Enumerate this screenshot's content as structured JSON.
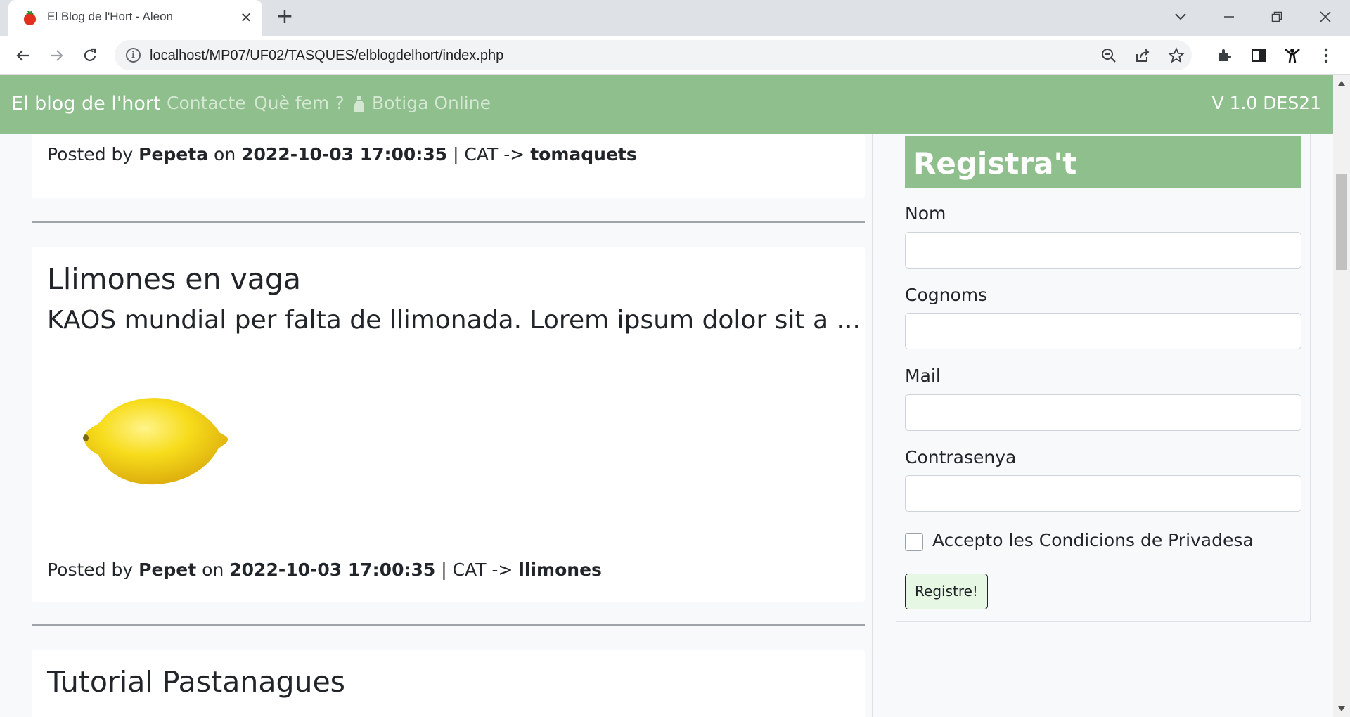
{
  "browser": {
    "tab_title": "El Blog de l'Hort - Aleon",
    "tab_close": "✕",
    "new_tab": "+",
    "url": "localhost/MP07/UF02/TASQUES/elblogdelhort/index.php"
  },
  "navbar": {
    "brand": "El blog de l'hort",
    "links": [
      "Contacte",
      "Què fem ?",
      "Botiga Online"
    ],
    "version": "V 1.0 DES21"
  },
  "posts": [
    {
      "meta": {
        "prefix": "Posted by",
        "author": "Pepeta",
        "on": "on",
        "date": "2022-10-03 17:00:35",
        "cat": "| CAT ->",
        "category": "tomaquets"
      }
    },
    {
      "title": "Llimones en vaga",
      "subtitle": "KAOS mundial per falta de llimonada. Lorem ipsum dolor sit a ...",
      "image": "lemon",
      "meta": {
        "prefix": "Posted by",
        "author": "Pepet",
        "on": "on",
        "date": "2022-10-03 17:00:35",
        "cat": "| CAT ->",
        "category": "llimones"
      }
    },
    {
      "title": "Tutorial Pastanagues"
    }
  ],
  "register": {
    "title": "Registra't",
    "fields": [
      {
        "label": "Nom",
        "value": ""
      },
      {
        "label": "Cognoms",
        "value": ""
      },
      {
        "label": "Mail",
        "value": ""
      },
      {
        "label": "Contrasenya",
        "value": ""
      }
    ],
    "checkbox_label": "Accepto les Condicions de Privadesa",
    "checkbox_checked": false,
    "button": "Registre!"
  },
  "colors": {
    "navbar": "#8fbf8d",
    "register_button": "#e6f7e4"
  }
}
